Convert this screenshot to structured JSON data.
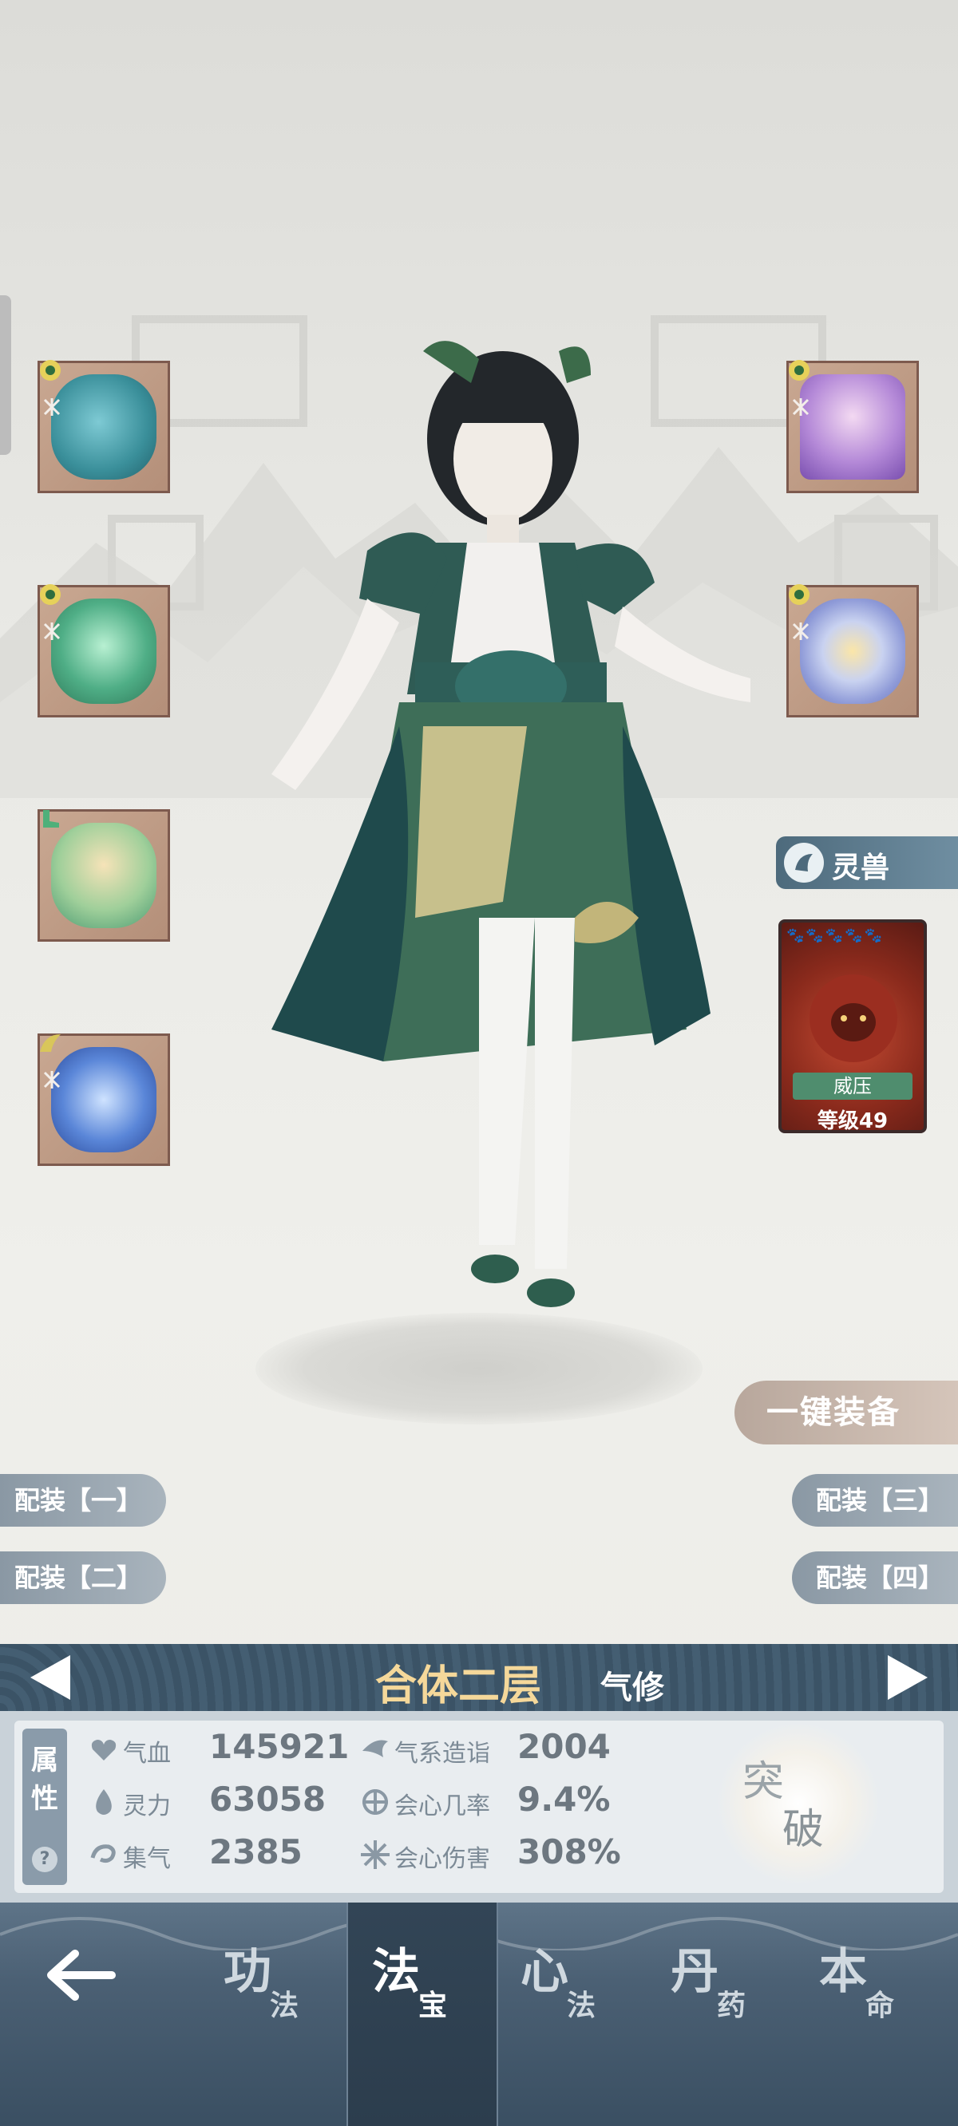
{
  "spirit_beast": {
    "tab_label": "灵兽",
    "skill": "威压",
    "level": "等级49"
  },
  "one_key_equip": "一键装备",
  "presets": [
    "配装【一】",
    "配装【二】",
    "配装【三】",
    "配装【四】"
  ],
  "realm": {
    "name": "合体二层",
    "type": "气修"
  },
  "attributes": {
    "tag": "属性",
    "help": "?",
    "stats": [
      {
        "icon": "heart-icon",
        "label": "气血",
        "value": "145921"
      },
      {
        "icon": "spirit-drop-icon",
        "label": "灵力",
        "value": "63058"
      },
      {
        "icon": "swirl-icon",
        "label": "集气",
        "value": "2385"
      },
      {
        "icon": "qi-wind-icon",
        "label": "气系造诣",
        "value": "2004"
      },
      {
        "icon": "crit-rate-icon",
        "label": "会心几率",
        "value": "9.4%"
      },
      {
        "icon": "crit-damage-icon",
        "label": "会心伤害",
        "value": "308%"
      }
    ]
  },
  "breakthrough": {
    "char1": "突",
    "char2": "破"
  },
  "nav": {
    "back_icon": "back-arrow-icon",
    "tabs": [
      {
        "big": "功",
        "small": "法",
        "active": false
      },
      {
        "big": "法",
        "small": "宝",
        "active": true
      },
      {
        "big": "心",
        "small": "法",
        "active": false
      },
      {
        "big": "丹",
        "small": "药",
        "active": false
      },
      {
        "big": "本",
        "small": "命",
        "active": false
      }
    ]
  },
  "colors": {
    "realm_name": "#f5d89a",
    "panel_bg": "#e9edf0",
    "nav_bg": "#4b6074",
    "slot_border": "#7d5a4e"
  }
}
